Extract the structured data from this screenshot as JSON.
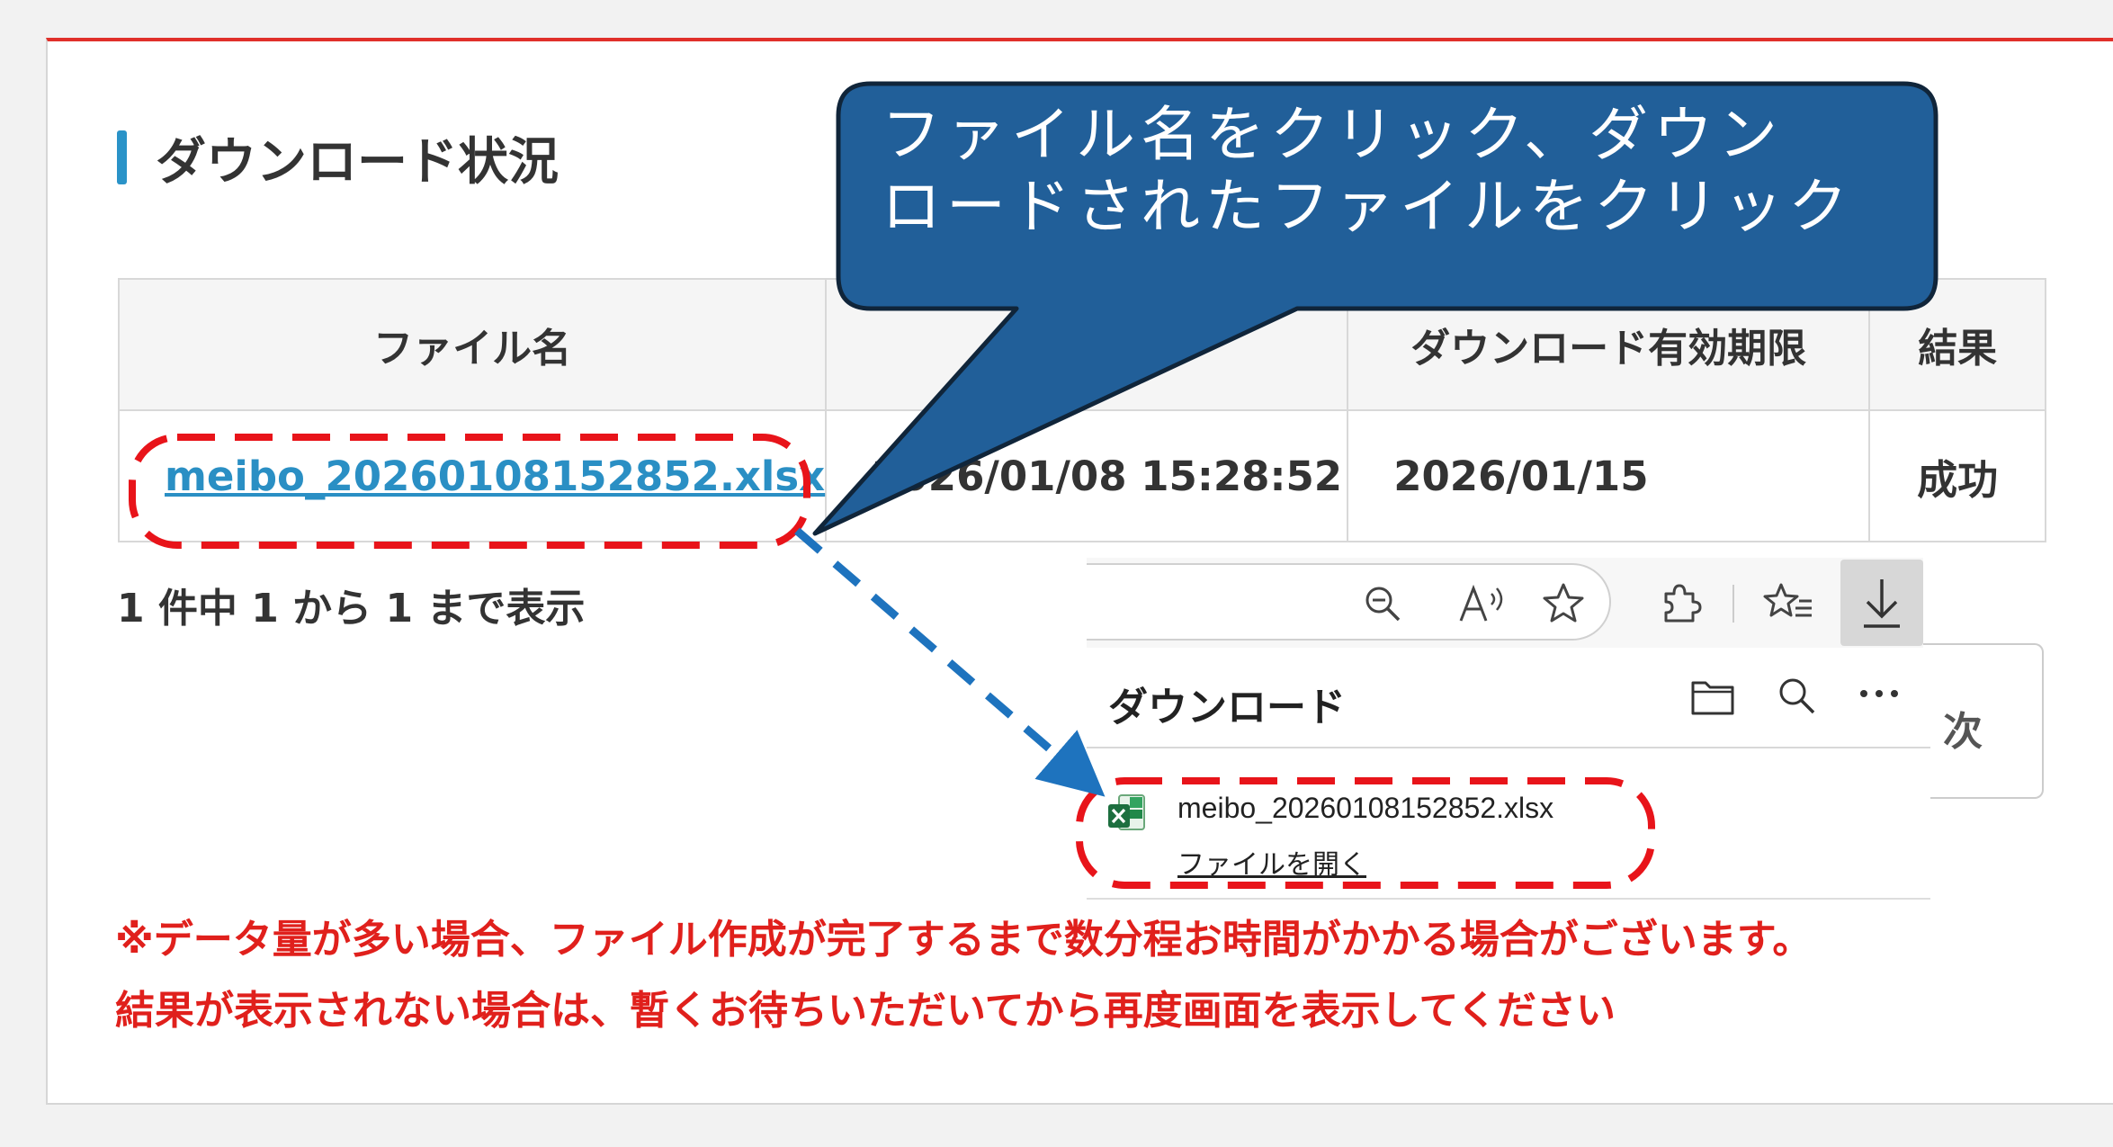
{
  "section": {
    "title": "ダウンロード状況"
  },
  "table": {
    "headers": [
      "ファイル名",
      "",
      "ダウンロード有効期限",
      "結果"
    ],
    "rows": [
      {
        "file_name": "meibo_20260108152852.xlsx",
        "created": "2026/01/08 15:28:52",
        "expires": "2026/01/15",
        "result": "成功"
      }
    ]
  },
  "pager_info": "1 件中 1 から 1 まで表示",
  "background_card_text": "次",
  "browser": {
    "icons": [
      "zoom-out-icon",
      "read-aloud-icon",
      "favorite-star-icon",
      "extensions-icon",
      "favorites-list-icon",
      "download-icon"
    ],
    "downloads": {
      "title": "ダウンロード",
      "item_name": "meibo_20260108152852.xlsx",
      "open_link": "ファイルを開く",
      "icons": [
        "folder-icon",
        "search-icon",
        "more-icon",
        "excel-file-icon"
      ]
    }
  },
  "callout": {
    "line1": "ファイル名をクリック、ダウン",
    "line2": "ロードされたファイルをクリック"
  },
  "note": {
    "line1": "※データ量が多い場合、ファイル作成が完了するまで数分程お時間がかかる場合がございます。",
    "line2": "結果が表示されない場合は、暫くお待ちいただいてから再度画面を表示してください"
  },
  "colors": {
    "accent_red": "#e0302a",
    "link_blue": "#2a8fc4",
    "callout_blue": "#1f5f9a",
    "highlight_red": "#e8141a",
    "arrow_blue": "#1e73be"
  }
}
